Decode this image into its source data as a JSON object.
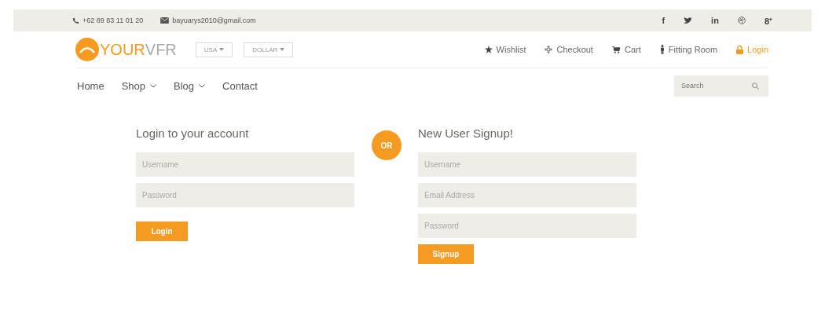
{
  "topbar": {
    "phone": "+62 89 83 11 01 20",
    "email": "bayuarys2010@gmail.com",
    "social": [
      {
        "kind": "text",
        "text": "f"
      },
      {
        "kind": "bird"
      },
      {
        "kind": "text",
        "text": "in"
      },
      {
        "kind": "ball"
      },
      {
        "kind": "text",
        "text": "8⁺"
      }
    ]
  },
  "header": {
    "logo": {
      "part1": "YOUR",
      "part2": "VFR"
    },
    "selects": [
      {
        "label": "USA"
      },
      {
        "label": "DOLLAR"
      }
    ],
    "links": [
      {
        "kind": "star",
        "label": "Wishlist",
        "active": false
      },
      {
        "kind": "crosshair",
        "label": "Checkout",
        "active": false
      },
      {
        "kind": "cart",
        "label": "Cart",
        "active": false
      },
      {
        "kind": "person",
        "label": "Fitting Room",
        "active": false
      },
      {
        "kind": "lock",
        "label": "Login",
        "active": true
      }
    ]
  },
  "nav": {
    "items": [
      {
        "label": "Home",
        "dropdown": false
      },
      {
        "label": "Shop",
        "dropdown": true
      },
      {
        "label": "Blog",
        "dropdown": true
      },
      {
        "label": "Contact",
        "dropdown": false
      }
    ],
    "search": {
      "placeholder": "Search"
    }
  },
  "login": {
    "title": "Login to your account",
    "fields": [
      {
        "placeholder": "Username"
      },
      {
        "placeholder": "Password"
      }
    ],
    "button": "Login"
  },
  "separator": "OR",
  "signup": {
    "title": "New User Signup!",
    "fields": [
      {
        "placeholder": "Username"
      },
      {
        "placeholder": "Email Address"
      },
      {
        "placeholder": "Password"
      }
    ],
    "button": "Signup"
  }
}
